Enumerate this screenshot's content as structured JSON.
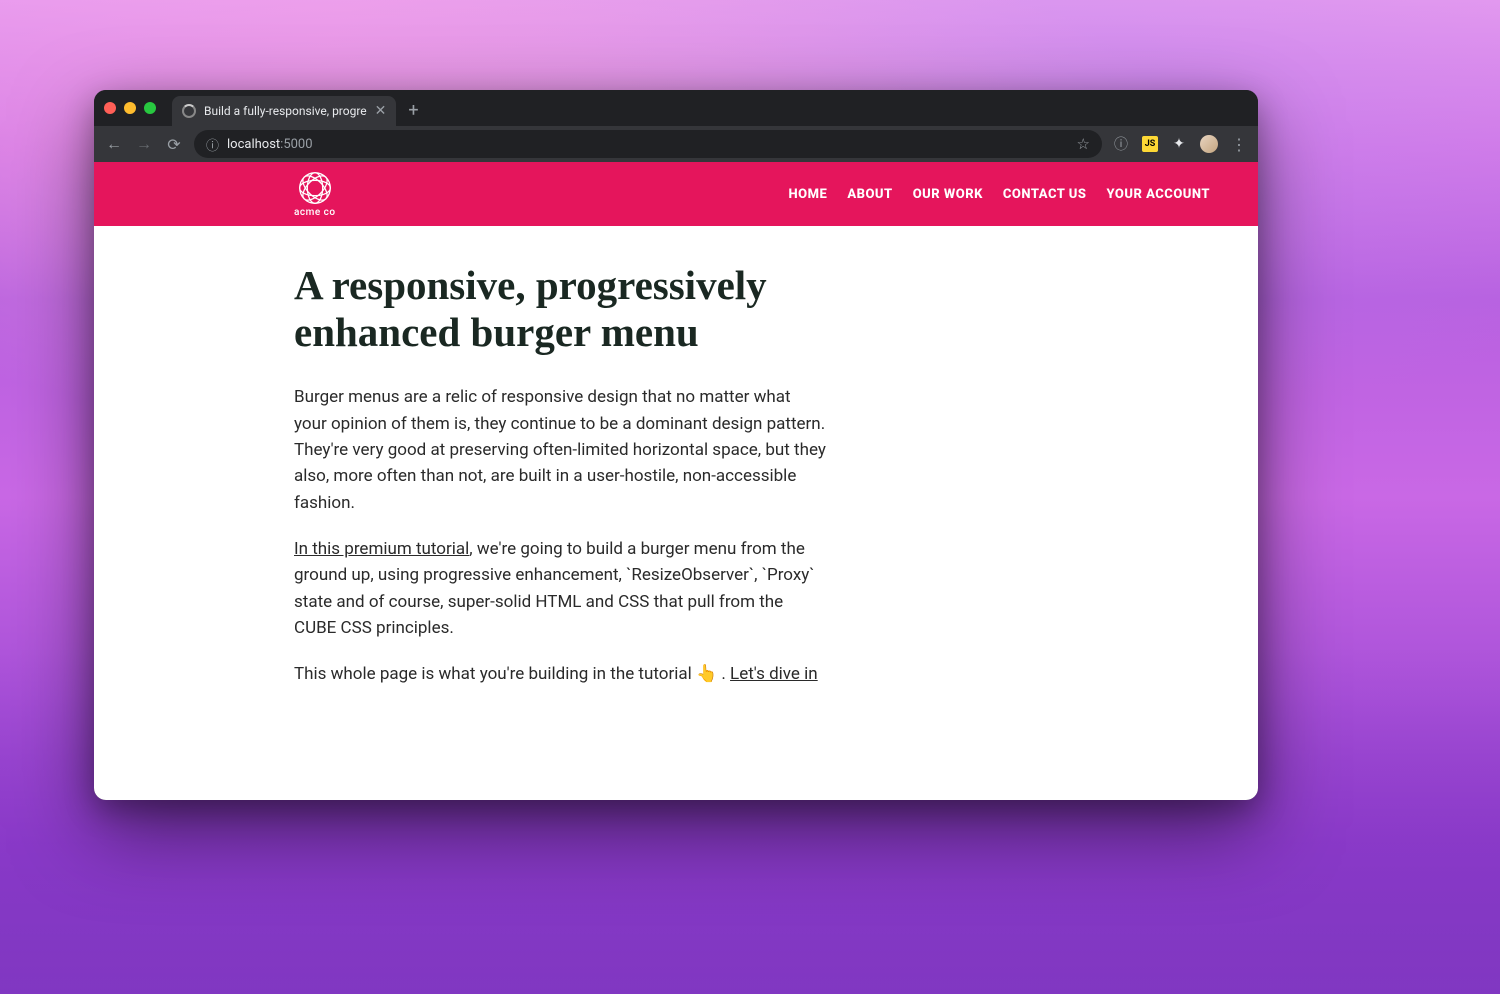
{
  "browser": {
    "tab_title": "Build a fully-responsive, progre",
    "url_host": "localhost",
    "url_port": ":5000"
  },
  "site": {
    "logo_text": "acme co",
    "nav": [
      "HOME",
      "ABOUT",
      "OUR WORK",
      "CONTACT US",
      "YOUR ACCOUNT"
    ]
  },
  "article": {
    "title": "A responsive, progressively enhanced burger menu",
    "p1": "Burger menus are a relic of responsive design that no matter what your opinion of them is, they continue to be a dominant design pattern. They're very good at preserving often-limited horizontal space, but they also, more often than not, are built in a user-hostile, non-accessible fashion.",
    "p2_link": "In this premium tutorial",
    "p2_rest": ", we're going to build a burger menu from the ground up, using progressive enhancement, `ResizeObserver`, `Proxy` state and of course, super-solid HTML and CSS that pull from the CUBE CSS principles.",
    "p3_pre": "This whole page is what you're building in the tutorial ",
    "p3_emoji": "👆",
    "p3_sep": " . ",
    "p3_link": "Let's dive in"
  }
}
